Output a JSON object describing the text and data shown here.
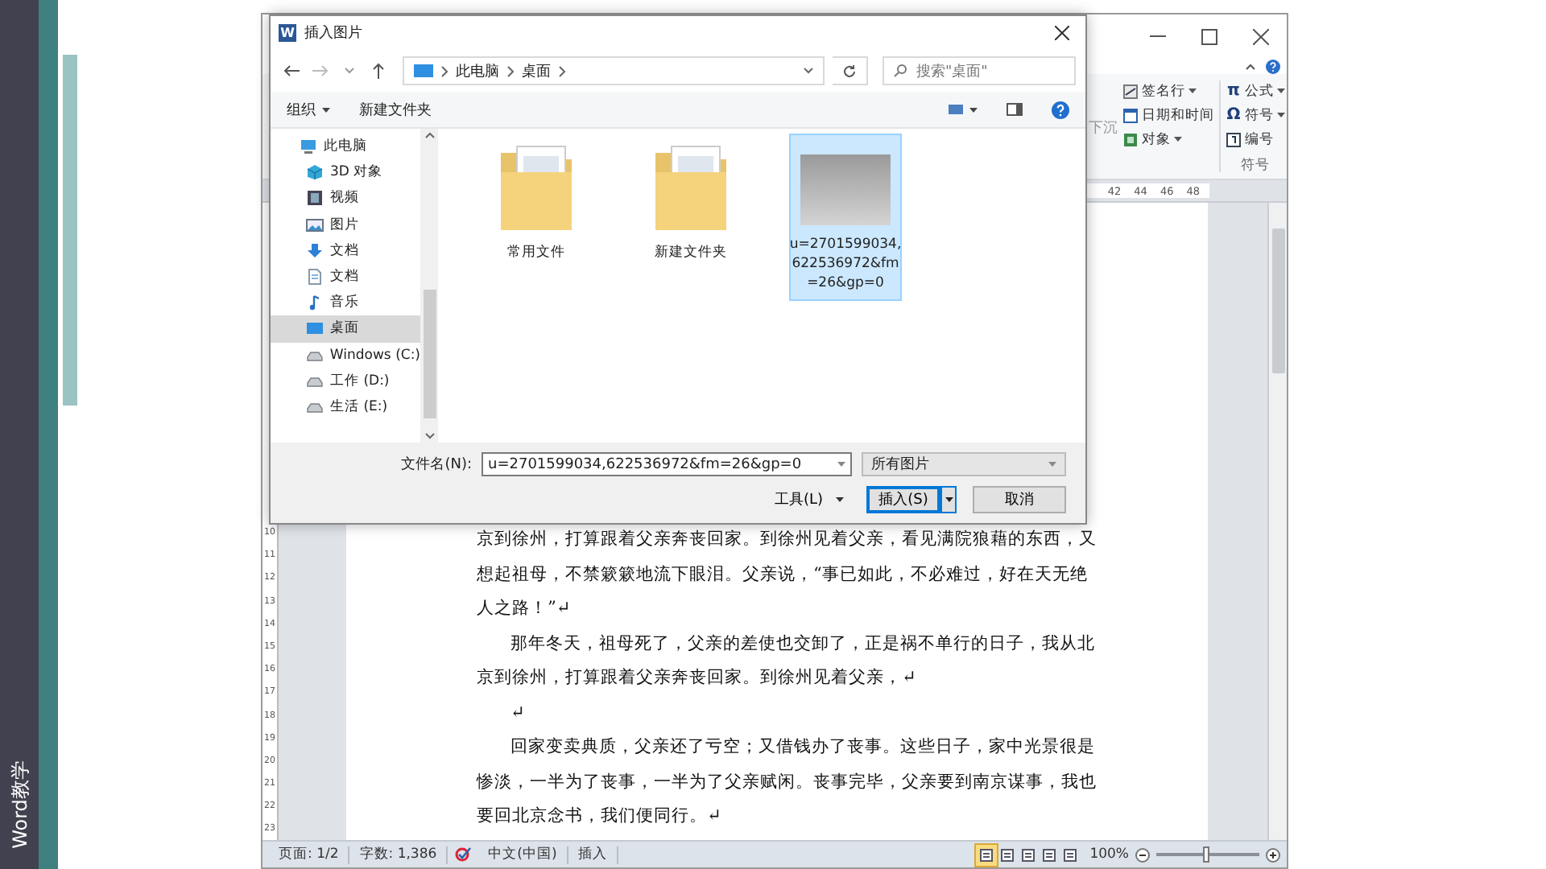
{
  "slide": {
    "side_title": "Word教学"
  },
  "word": {
    "ribbon": {
      "partial_label": "下沉",
      "groups": [
        {
          "items": [
            {
              "label": "签名行",
              "kind": "signature",
              "dropdown": true
            },
            {
              "label": "日期和时间",
              "kind": "calendar",
              "dropdown": false
            },
            {
              "label": "对象",
              "kind": "object",
              "dropdown": true
            }
          ]
        },
        {
          "label": "符号",
          "items": [
            {
              "label": "公式",
              "kind": "glyph",
              "glyph": "π",
              "dropdown": true
            },
            {
              "label": "符号",
              "kind": "glyph",
              "glyph": "Ω",
              "dropdown": true
            },
            {
              "label": "编号",
              "kind": "number",
              "dropdown": false
            }
          ]
        }
      ]
    },
    "ruler_ticks": [
      "42",
      "44",
      "46",
      "48"
    ],
    "vertical_ruler_ticks": [
      "10",
      "11",
      "12",
      "13",
      "14",
      "15",
      "16",
      "17",
      "18",
      "19",
      "20",
      "21",
      "22",
      "23"
    ],
    "paragraphs": [
      {
        "indent": false,
        "lines": [
          "京到徐州，打算跟着父亲奔丧回家。到徐州见着父亲，看见满院狼藉的东西，又",
          "想起祖母，不禁簌簌地流下眼泪。父亲说，“事已如此，不必难过，好在天无绝",
          "人之路！”↵"
        ]
      },
      {
        "indent": true,
        "lines": [
          "那年冬天，祖母死了，父亲的差使也交卸了，正是祸不单行的日子，我从北",
          "京到徐州，打算跟着父亲奔丧回家。到徐州见着父亲，↵"
        ]
      },
      {
        "indent": true,
        "lines": [
          "↵"
        ]
      },
      {
        "indent": true,
        "lines": [
          "回家变卖典质，父亲还了亏空；又借钱办了丧事。这些日子，家中光景很是",
          "惨淡，一半为了丧事，一半为了父亲赋闲。丧事完毕，父亲要到南京谋事，我也",
          "要回北京念书，我们便同行。↵"
        ]
      }
    ],
    "status_bar": {
      "page": "页面: 1/2",
      "words": "字数: 1,386",
      "language": "中文(中国)",
      "mode": "插入",
      "views": [
        {
          "selected": true
        },
        {
          "selected": false
        },
        {
          "selected": false
        },
        {
          "selected": false
        },
        {
          "selected": false
        }
      ],
      "zoom": "100%",
      "zoom_slider": {
        "level": 0.5
      }
    }
  },
  "dialog": {
    "app_icon_letter": "W",
    "title": "插入图片",
    "breadcrumb": [
      "此电脑",
      "桌面"
    ],
    "search": {
      "placeholder": "搜索\"桌面\""
    },
    "toolbar": {
      "organize": "组织",
      "new_folder": "新建文件夹"
    },
    "nav_tree": [
      {
        "label": "此电脑",
        "kind": "pc",
        "selected": false,
        "children": [
          {
            "label": "3D 对象",
            "kind": "cube",
            "selected": false
          },
          {
            "label": "视频",
            "kind": "video",
            "selected": false
          },
          {
            "label": "图片",
            "kind": "picture",
            "selected": false
          },
          {
            "label": "文档",
            "kind": "download",
            "selected": false
          },
          {
            "label": "文档",
            "kind": "document",
            "selected": false
          },
          {
            "label": "音乐",
            "kind": "music",
            "selected": false
          },
          {
            "label": "桌面",
            "kind": "desktop",
            "selected": true
          },
          {
            "label": "Windows (C:)",
            "kind": "drive",
            "selected": false
          },
          {
            "label": "工作 (D:)",
            "kind": "drive",
            "selected": false
          },
          {
            "label": "生活 (E:)",
            "kind": "drive",
            "selected": false
          }
        ]
      }
    ],
    "files": [
      {
        "kind": "folder",
        "name": "常用文件",
        "selected": false
      },
      {
        "kind": "folder",
        "name": "新建文件夹",
        "selected": false
      },
      {
        "kind": "image",
        "name": "u=2701599034,\n622536972&fm\n=26&gp=0",
        "selected": true
      }
    ],
    "filename_label": "文件名(N):",
    "filename": "u=2701599034,622536972&fm=26&gp=0",
    "filetype": "所有图片",
    "tools": "工具(L)",
    "insert": "插入(S)",
    "cancel": "取消"
  }
}
